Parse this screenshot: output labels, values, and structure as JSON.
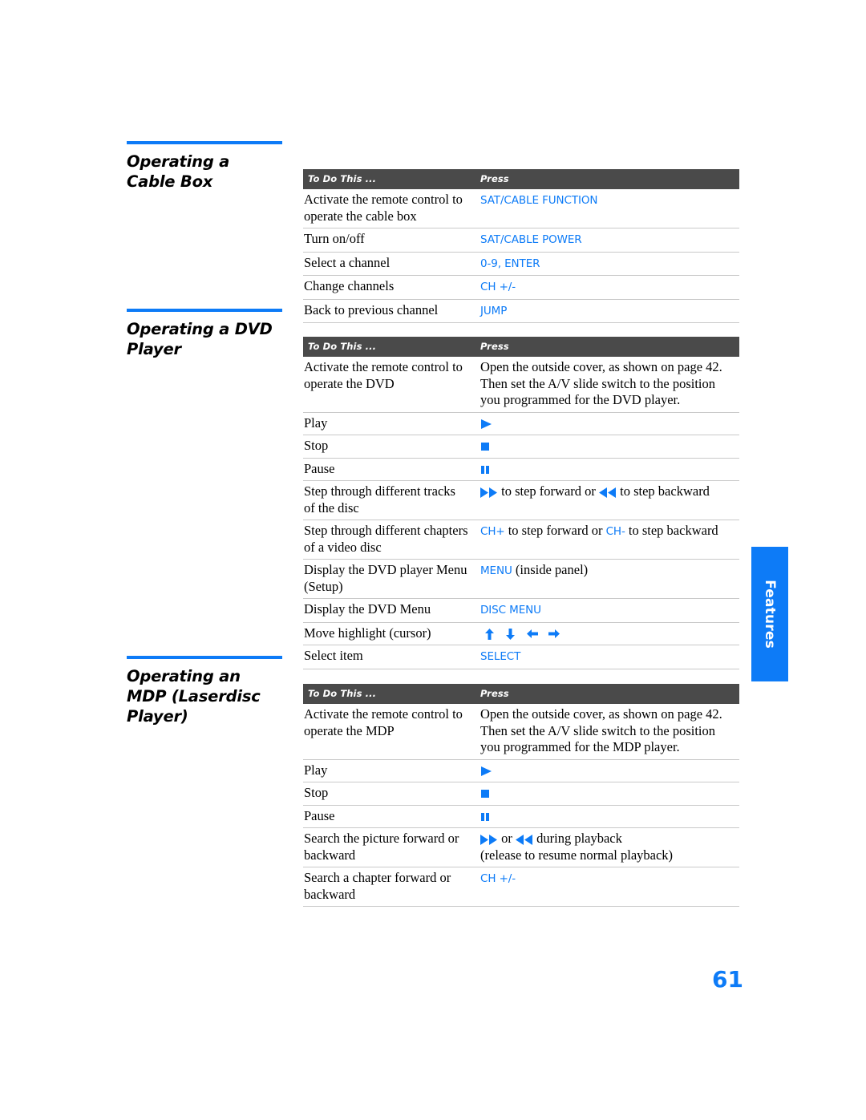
{
  "page": {
    "number": "61",
    "side_tab": "Features",
    "accent_color": "#0d7bf7",
    "header_bar_color": "#4a4a4a"
  },
  "columns": {
    "to_do": "To Do This ...",
    "press": "Press"
  },
  "sections": [
    {
      "id": "cable-box",
      "title": "Operating a Cable Box",
      "rows": [
        {
          "to_do": "Activate the remote control to operate the cable box",
          "press_text": "SAT/CABLE FUNCTION"
        },
        {
          "to_do": "Turn on/off",
          "press_text": "SAT/CABLE POWER"
        },
        {
          "to_do": "Select a channel",
          "press_text": "0-9, ENTER"
        },
        {
          "to_do": "Change channels",
          "press_text": "CH +/-"
        },
        {
          "to_do": "Back to previous channel",
          "press_text": "JUMP"
        }
      ]
    },
    {
      "id": "dvd-player",
      "title": "Operating a DVD Player",
      "rows": [
        {
          "to_do": "Activate the remote control to operate the DVD",
          "press_text": "Open the outside cover, as shown on page 42. Then set the A/V slide switch to the position you programmed for the DVD player."
        },
        {
          "to_do": "Play",
          "press_icon": "play-icon"
        },
        {
          "to_do": "Stop",
          "press_icon": "stop-icon"
        },
        {
          "to_do": "Pause",
          "press_icon": "pause-icon"
        },
        {
          "to_do": "Step through different tracks of the disc",
          "press_icon_a": "fast-forward-icon",
          "press_mid": "to step forward or",
          "press_icon_b": "rewind-icon",
          "press_end": "to step backward"
        },
        {
          "to_do": "Step through different chapters of a video disc",
          "press_blue_a": "CH+",
          "press_mid": "to step forward or",
          "press_blue_b": "CH-",
          "press_end": "to step backward"
        },
        {
          "to_do": "Display the DVD player Menu (Setup)",
          "press_blue_a": "MENU",
          "press_end": "(inside panel)"
        },
        {
          "to_do": "Display the DVD Menu",
          "press_text": "DISC MENU"
        },
        {
          "to_do": "Move highlight (cursor)",
          "press_arrows": [
            "arrow-up-icon",
            "arrow-down-icon",
            "arrow-left-icon",
            "arrow-right-icon"
          ]
        },
        {
          "to_do": "Select item",
          "press_text": "SELECT"
        }
      ]
    },
    {
      "id": "mdp-player",
      "title": "Operating an MDP (Laserdisc Player)",
      "rows": [
        {
          "to_do": "Activate the remote control to operate the MDP",
          "press_text": "Open the outside cover, as shown on page 42. Then set the A/V slide switch to the position you programmed for the MDP player."
        },
        {
          "to_do": "Play",
          "press_icon": "play-icon"
        },
        {
          "to_do": "Stop",
          "press_icon": "stop-icon"
        },
        {
          "to_do": "Pause",
          "press_icon": "pause-icon"
        },
        {
          "to_do": "Search the picture forward or backward",
          "press_icon_a": "fast-forward-icon",
          "press_mid": "or",
          "press_icon_b": "rewind-icon",
          "press_end": "during playback",
          "press_line2": "(release to resume normal playback)"
        },
        {
          "to_do": "Search a chapter forward or backward",
          "press_text": "CH +/-"
        }
      ]
    }
  ]
}
